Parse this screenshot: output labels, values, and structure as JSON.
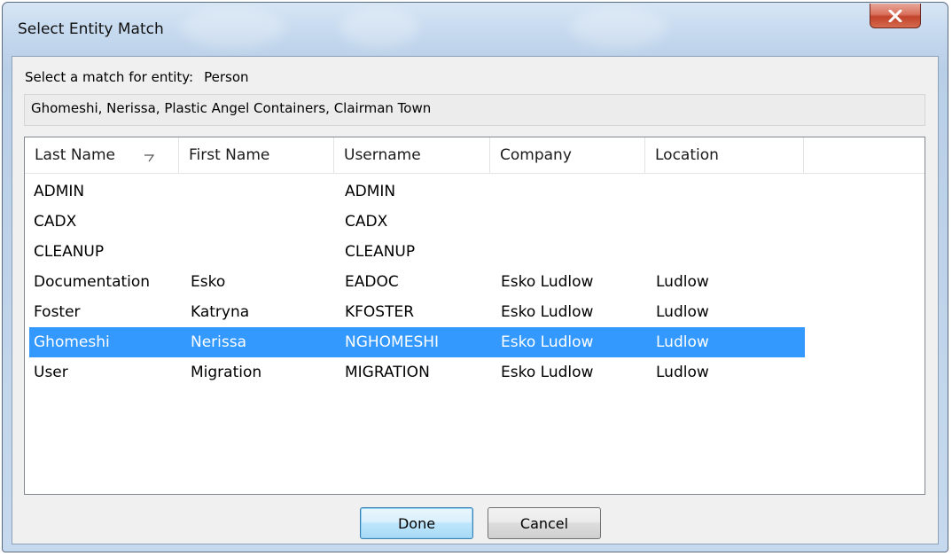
{
  "window": {
    "title": "Select Entity Match"
  },
  "prompt": {
    "label": "Select a match for entity:",
    "entity_type": "Person"
  },
  "entity_description": "Ghomeshi, Nerissa, Plastic Angel Containers, Clairman Town",
  "table": {
    "columns": [
      "Last Name",
      "First Name",
      "Username",
      "Company",
      "Location"
    ],
    "sort_icon": "sort-descending-icon",
    "rows": [
      {
        "last": "ADMIN",
        "first": "",
        "username": "ADMIN",
        "company": "",
        "location": ""
      },
      {
        "last": "CADX",
        "first": "",
        "username": "CADX",
        "company": "",
        "location": ""
      },
      {
        "last": "CLEANUP",
        "first": "",
        "username": "CLEANUP",
        "company": "",
        "location": ""
      },
      {
        "last": "Documentation",
        "first": "Esko",
        "username": "EADOC",
        "company": "Esko Ludlow",
        "location": "Ludlow"
      },
      {
        "last": "Foster",
        "first": "Katryna",
        "username": "KFOSTER",
        "company": "Esko Ludlow",
        "location": "Ludlow"
      },
      {
        "last": "Ghomeshi",
        "first": "Nerissa",
        "username": "NGHOMESHI",
        "company": "Esko Ludlow",
        "location": "Ludlow"
      },
      {
        "last": "User",
        "first": "Migration",
        "username": "MIGRATION",
        "company": "Esko Ludlow",
        "location": "Ludlow"
      }
    ],
    "selected_row": "Ghomeshi"
  },
  "buttons": {
    "done": "Done",
    "cancel": "Cancel"
  },
  "icons": {
    "close": "close-icon"
  },
  "colors": {
    "selection": "#3399ff",
    "close_button": "#c2432b"
  }
}
